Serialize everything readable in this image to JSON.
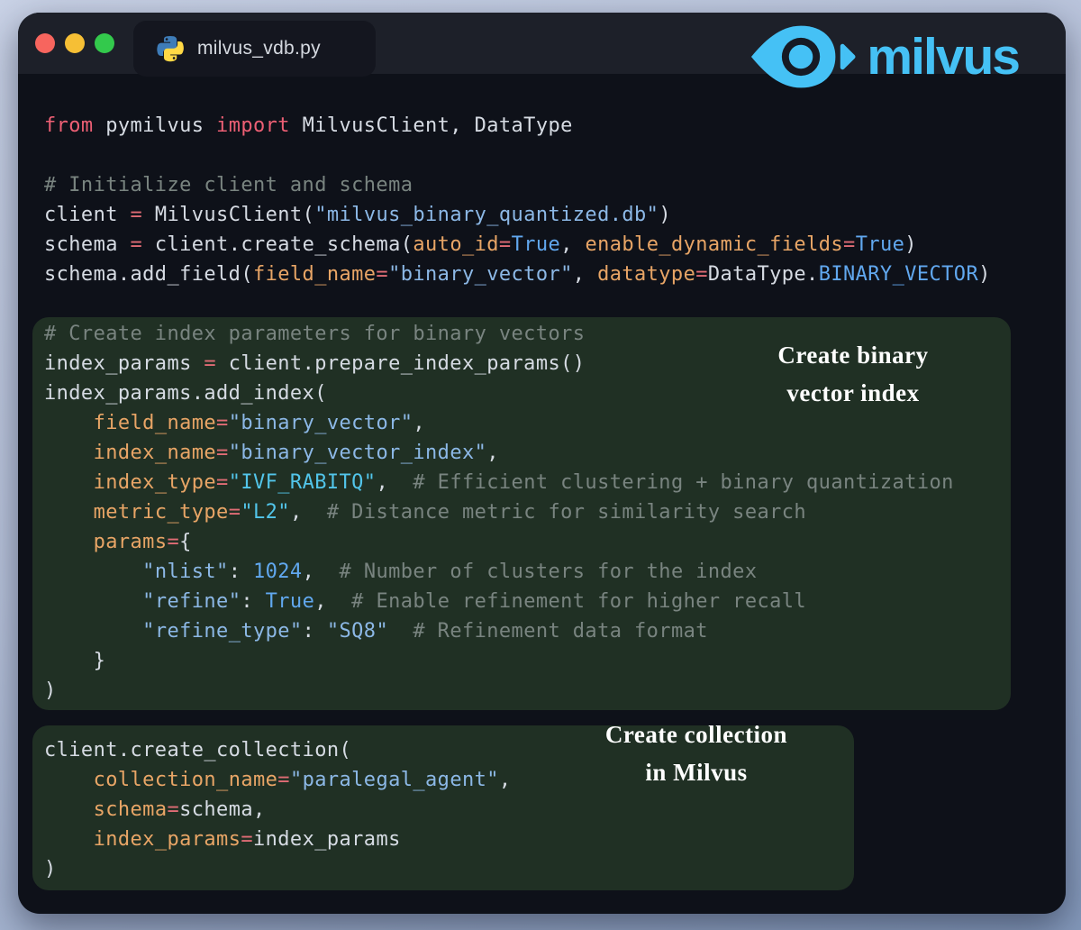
{
  "window": {
    "tab": {
      "filename": "milvus_vdb.py"
    }
  },
  "brand": {
    "name": "milvus"
  },
  "palette": {
    "brand_blue": "#45c1f5",
    "window_bg": "#0e1119",
    "titlebar_bg": "#1d2029",
    "tab_bg": "#14161f",
    "highlight_box_green": "#203024",
    "keyword_red": "#ec5f74",
    "operator_red": "#e06c75",
    "param_orange": "#e8a566",
    "string_blue": "#8cb8e6",
    "constant_blue": "#61a8ef",
    "special_cyan": "#52c5ea",
    "comment_gray": "#798480",
    "traffic_red": "#f7655e",
    "traffic_yellow": "#f6bf35",
    "traffic_green": "#33c94c"
  },
  "annotations": [
    {
      "lines": [
        "Create binary",
        "vector index"
      ]
    },
    {
      "lines": [
        "Create collection",
        "in Milvus"
      ]
    }
  ],
  "code": {
    "lines": [
      {
        "tokens": [
          {
            "c": "kw",
            "t": "from"
          },
          {
            "c": "txt",
            "t": " pymilvus "
          },
          {
            "c": "kw",
            "t": "import"
          },
          {
            "c": "txt",
            "t": " MilvusClient, DataType"
          }
        ]
      },
      {
        "tokens": []
      },
      {
        "tokens": [
          {
            "c": "cmt",
            "t": "# Initialize client and schema"
          }
        ]
      },
      {
        "tokens": [
          {
            "c": "txt",
            "t": "client "
          },
          {
            "c": "op",
            "t": "="
          },
          {
            "c": "txt",
            "t": " MilvusClient("
          },
          {
            "c": "str",
            "t": "\"milvus_binary_quantized.db\""
          },
          {
            "c": "txt",
            "t": ")"
          }
        ]
      },
      {
        "tokens": [
          {
            "c": "txt",
            "t": "schema "
          },
          {
            "c": "op",
            "t": "="
          },
          {
            "c": "txt",
            "t": " client.create_schema("
          },
          {
            "c": "param",
            "t": "auto_id"
          },
          {
            "c": "op",
            "t": "="
          },
          {
            "c": "const",
            "t": "True"
          },
          {
            "c": "txt",
            "t": ", "
          },
          {
            "c": "param",
            "t": "enable_dynamic_fields"
          },
          {
            "c": "op",
            "t": "="
          },
          {
            "c": "const",
            "t": "True"
          },
          {
            "c": "txt",
            "t": ")"
          }
        ]
      },
      {
        "tokens": [
          {
            "c": "txt",
            "t": "schema.add_field("
          },
          {
            "c": "param",
            "t": "field_name"
          },
          {
            "c": "op",
            "t": "="
          },
          {
            "c": "str",
            "t": "\"binary_vector\""
          },
          {
            "c": "txt",
            "t": ", "
          },
          {
            "c": "param",
            "t": "datatype"
          },
          {
            "c": "op",
            "t": "="
          },
          {
            "c": "txt",
            "t": "DataType."
          },
          {
            "c": "const",
            "t": "BINARY_VECTOR"
          },
          {
            "c": "txt",
            "t": ")"
          }
        ]
      },
      {
        "tokens": []
      },
      {
        "tokens": [
          {
            "c": "cmt",
            "t": "# Create index parameters for binary vectors"
          }
        ]
      },
      {
        "tokens": [
          {
            "c": "txt",
            "t": "index_params "
          },
          {
            "c": "op",
            "t": "="
          },
          {
            "c": "txt",
            "t": " client.prepare_index_params()"
          }
        ]
      },
      {
        "tokens": [
          {
            "c": "txt",
            "t": "index_params.add_index("
          }
        ]
      },
      {
        "tokens": [
          {
            "c": "txt",
            "t": "    "
          },
          {
            "c": "param",
            "t": "field_name"
          },
          {
            "c": "op",
            "t": "="
          },
          {
            "c": "str",
            "t": "\"binary_vector\""
          },
          {
            "c": "txt",
            "t": ","
          }
        ]
      },
      {
        "tokens": [
          {
            "c": "txt",
            "t": "    "
          },
          {
            "c": "param",
            "t": "index_name"
          },
          {
            "c": "op",
            "t": "="
          },
          {
            "c": "str",
            "t": "\"binary_vector_index\""
          },
          {
            "c": "txt",
            "t": ","
          }
        ]
      },
      {
        "tokens": [
          {
            "c": "txt",
            "t": "    "
          },
          {
            "c": "param",
            "t": "index_type"
          },
          {
            "c": "op",
            "t": "="
          },
          {
            "c": "cyan",
            "t": "\"IVF_RABITQ\""
          },
          {
            "c": "txt",
            "t": ",  "
          },
          {
            "c": "cmt",
            "t": "# Efficient clustering + binary quantization"
          }
        ]
      },
      {
        "tokens": [
          {
            "c": "txt",
            "t": "    "
          },
          {
            "c": "param",
            "t": "metric_type"
          },
          {
            "c": "op",
            "t": "="
          },
          {
            "c": "cyan",
            "t": "\"L2\""
          },
          {
            "c": "txt",
            "t": ",  "
          },
          {
            "c": "cmt",
            "t": "# Distance metric for similarity search"
          }
        ]
      },
      {
        "tokens": [
          {
            "c": "txt",
            "t": "    "
          },
          {
            "c": "param",
            "t": "params"
          },
          {
            "c": "op",
            "t": "="
          },
          {
            "c": "txt",
            "t": "{"
          }
        ]
      },
      {
        "tokens": [
          {
            "c": "txt",
            "t": "        "
          },
          {
            "c": "str",
            "t": "\"nlist\""
          },
          {
            "c": "txt",
            "t": ": "
          },
          {
            "c": "const",
            "t": "1024"
          },
          {
            "c": "txt",
            "t": ",  "
          },
          {
            "c": "cmt",
            "t": "# Number of clusters for the index"
          }
        ]
      },
      {
        "tokens": [
          {
            "c": "txt",
            "t": "        "
          },
          {
            "c": "str",
            "t": "\"refine\""
          },
          {
            "c": "txt",
            "t": ": "
          },
          {
            "c": "const",
            "t": "True"
          },
          {
            "c": "txt",
            "t": ",  "
          },
          {
            "c": "cmt",
            "t": "# Enable refinement for higher recall"
          }
        ]
      },
      {
        "tokens": [
          {
            "c": "txt",
            "t": "        "
          },
          {
            "c": "str",
            "t": "\"refine_type\""
          },
          {
            "c": "txt",
            "t": ": "
          },
          {
            "c": "str",
            "t": "\"SQ8\""
          },
          {
            "c": "txt",
            "t": "  "
          },
          {
            "c": "cmt",
            "t": "# Refinement data format"
          }
        ]
      },
      {
        "tokens": [
          {
            "c": "txt",
            "t": "    }"
          }
        ]
      },
      {
        "tokens": [
          {
            "c": "txt",
            "t": ")"
          }
        ]
      },
      {
        "tokens": []
      },
      {
        "tokens": [
          {
            "c": "txt",
            "t": "client.create_collection("
          }
        ]
      },
      {
        "tokens": [
          {
            "c": "txt",
            "t": "    "
          },
          {
            "c": "param",
            "t": "collection_name"
          },
          {
            "c": "op",
            "t": "="
          },
          {
            "c": "str",
            "t": "\"paralegal_agent\""
          },
          {
            "c": "txt",
            "t": ","
          }
        ]
      },
      {
        "tokens": [
          {
            "c": "txt",
            "t": "    "
          },
          {
            "c": "param",
            "t": "schema"
          },
          {
            "c": "op",
            "t": "="
          },
          {
            "c": "txt",
            "t": "schema,"
          }
        ]
      },
      {
        "tokens": [
          {
            "c": "txt",
            "t": "    "
          },
          {
            "c": "param",
            "t": "index_params"
          },
          {
            "c": "op",
            "t": "="
          },
          {
            "c": "txt",
            "t": "index_params"
          }
        ]
      },
      {
        "tokens": [
          {
            "c": "txt",
            "t": ")"
          }
        ]
      }
    ]
  }
}
